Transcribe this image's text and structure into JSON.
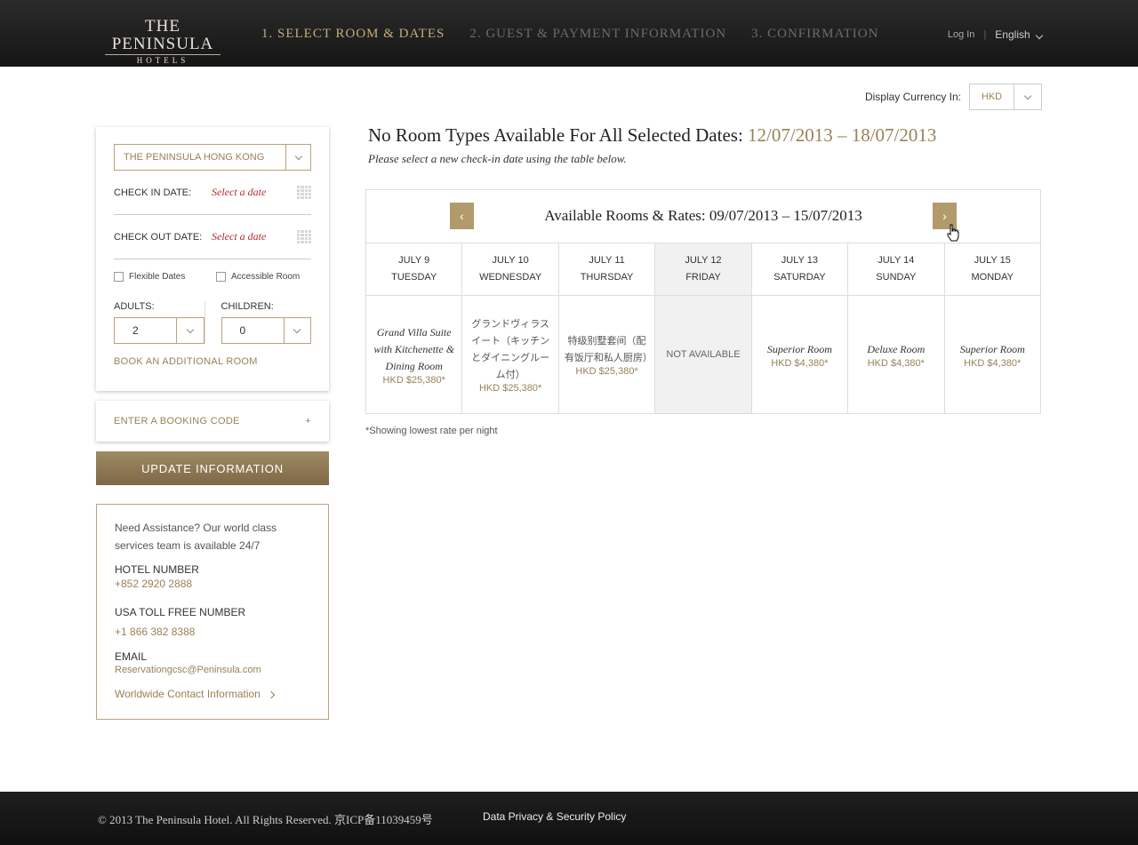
{
  "header": {
    "logo_line1": "THE PENINSULA",
    "logo_line2": "HOTELS",
    "steps": [
      "1. SELECT ROOM & DATES",
      "2. GUEST & PAYMENT INFORMATION",
      "3. CONFIRMATION"
    ],
    "login": "Log In",
    "language": "English"
  },
  "currency": {
    "label": "Display Currency In:",
    "value": "HKD"
  },
  "booking": {
    "hotel": "THE PENINSULA HONG KONG",
    "checkin_label": "CHECK IN DATE:",
    "checkin_value": "Select a date",
    "checkout_label": "CHECK OUT DATE:",
    "checkout_value": "Select a date",
    "flexible_label": "Flexible Dates",
    "accessible_label": "Accessible Room",
    "adults_label": "ADULTS:",
    "adults_value": "2",
    "children_label": "CHILDREN:",
    "children_value": "0",
    "add_room": "BOOK AN ADDITIONAL ROOM"
  },
  "booking_code": {
    "label": "ENTER A BOOKING CODE",
    "icon": "+"
  },
  "update_button": "UPDATE INFORMATION",
  "assistance": {
    "intro": "Need Assistance? Our world class services team is available 24/7",
    "hotel_label": "HOTEL NUMBER",
    "hotel_number": "+852 2920 2888",
    "usa_label": "USA TOLL FREE NUMBER",
    "usa_number": "+1 866 382 8388",
    "email_label": "EMAIL",
    "email": "Reservationgcsc@Peninsula.com",
    "worldwide": "Worldwide Contact Information"
  },
  "main": {
    "title": "No Room Types Available For All Selected Dates:",
    "title_dates": "12/07/2013 – 18/07/2013",
    "subtitle": "Please select a new check-in date using the table below.",
    "grid_title": "Available Rooms & Rates: 09/07/2013 – 15/07/2013",
    "note": "*Showing lowest rate per night",
    "days": [
      {
        "date": "JULY 9",
        "weekday": "TUESDAY",
        "room": "Grand Villa Suite with Kitchenette & Dining Room",
        "price": "HKD $25,380*",
        "available": true,
        "cjk": false
      },
      {
        "date": "JULY 10",
        "weekday": "WEDNESDAY",
        "room": "グランドヴィラスイート（キッチンとダイニングルーム付）",
        "price": "HKD $25,380*",
        "available": true,
        "cjk": true
      },
      {
        "date": "JULY 11",
        "weekday": "THURSDAY",
        "room": "特级别墅套间（配有饭厅和私人厨房）",
        "price": "HKD $25,380*",
        "available": true,
        "cjk": true
      },
      {
        "date": "JULY 12",
        "weekday": "FRIDAY",
        "room": "NOT AVAILABLE",
        "price": "",
        "available": false,
        "cjk": false
      },
      {
        "date": "JULY 13",
        "weekday": "SATURDAY",
        "room": "Superior Room",
        "price": "HKD $4,380*",
        "available": true,
        "cjk": false
      },
      {
        "date": "JULY 14",
        "weekday": "SUNDAY",
        "room": "Deluxe Room",
        "price": "HKD $4,380*",
        "available": true,
        "cjk": false
      },
      {
        "date": "JULY 15",
        "weekday": "MONDAY",
        "room": "Superior Room",
        "price": "HKD $4,380*",
        "available": true,
        "cjk": false
      }
    ]
  },
  "footer": {
    "copyright": "© 2013 The Peninsula Hotel. All Rights Reserved. 京ICP备11039459号",
    "privacy": "Data Privacy & Security Policy"
  }
}
